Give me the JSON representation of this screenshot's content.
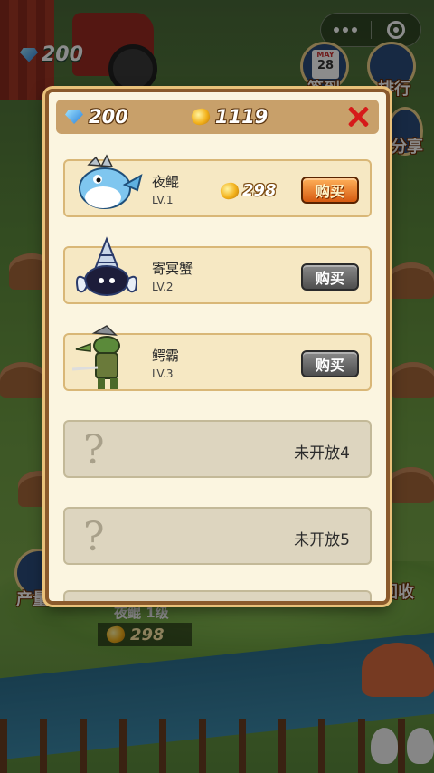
{
  "scene": {
    "gems": "200",
    "side_buttons": {
      "sign_in": "签到",
      "ranking": "排行",
      "share": "分享",
      "production": "产量",
      "recycle": "回收"
    },
    "calendar": {
      "month": "MAY",
      "day": "28"
    },
    "bottom_pet_name": "夜鲲 1级",
    "bottom_cost": "298"
  },
  "modal": {
    "gems": "200",
    "gold": "1119",
    "items": [
      {
        "name": "夜鲲",
        "level": "LV.1",
        "price": "298",
        "buy_label": "购买",
        "active": true
      },
      {
        "name": "寄冥蟹",
        "level": "LV.2",
        "buy_label": "购买",
        "active": false
      },
      {
        "name": "鳄霸",
        "level": "LV.3",
        "buy_label": "购买",
        "active": false
      }
    ],
    "locked": [
      {
        "symbol": "?",
        "label": "未开放4"
      },
      {
        "symbol": "?",
        "label": "未开放5"
      }
    ]
  },
  "colors": {
    "accent": "#d65a10",
    "close": "#d61a1a",
    "panel": "#fbf5e0"
  }
}
